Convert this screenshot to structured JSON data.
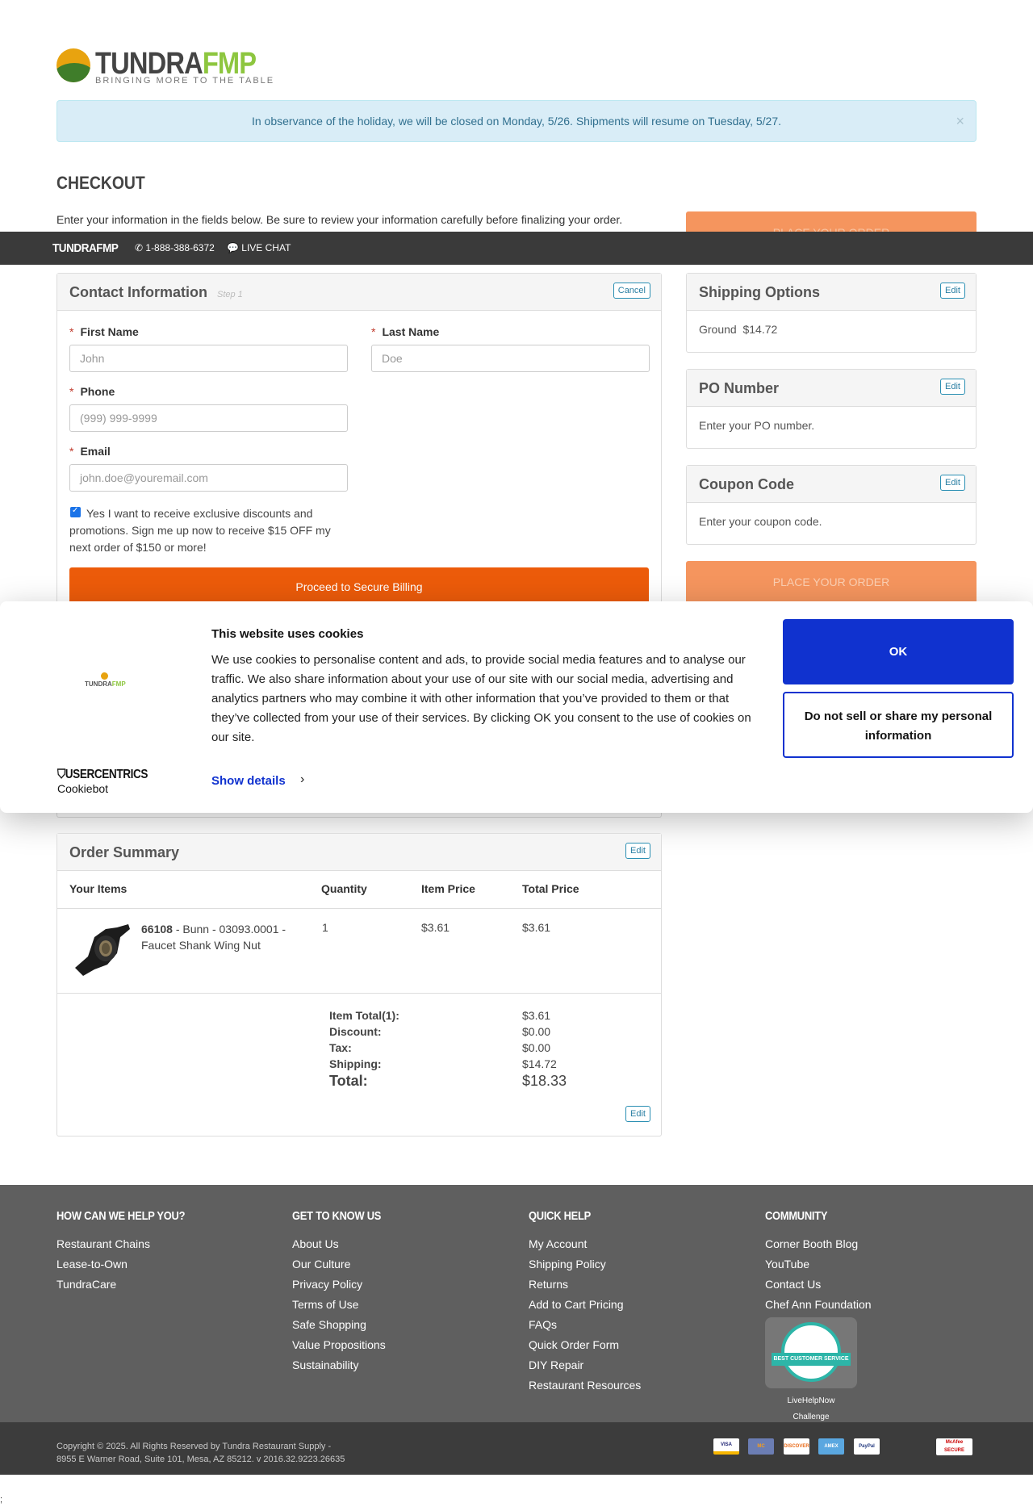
{
  "header": {
    "logo_part1": "TUNDRA",
    "logo_part2": "FMP",
    "tagline": "BRINGING MORE TO THE TABLE",
    "notice": "In observance of the holiday, we will be closed on Monday, 5/26. Shipments will resume on Tuesday, 5/27.",
    "notice_close": "×"
  },
  "checkout": {
    "title": "CHECKOUT",
    "intro": "Enter your information in the fields below. Be sure to review your information carefully before finalizing your order.",
    "place_order_label": "PLACE YOUR ORDER"
  },
  "sticky_bar": {
    "brand": "TUNDRAFMP",
    "phone": "1-888-388-6372",
    "chat": "LIVE CHAT"
  },
  "contact": {
    "title": "Contact Information",
    "step": "Step 1",
    "cancel_label": "Cancel",
    "first_name_label": "First Name",
    "first_name_placeholder": "John",
    "last_name_label": "Last Name",
    "last_name_placeholder": "Doe",
    "phone_label": "Phone",
    "phone_placeholder": "(999) 999-9999",
    "email_label": "Email",
    "email_placeholder": "john.doe@youremail.com",
    "required_mark": "*",
    "optin_text": "Yes I want to receive exclusive discounts and promotions. Sign me up now to receive $15 OFF my next order of $150 or more!",
    "optin_checked": true,
    "proceed_label": "Proceed to Secure Billing"
  },
  "side_panels": {
    "shipping": {
      "title": "Shipping Options",
      "edit": "Edit",
      "value": "Ground  $14.72"
    },
    "po": {
      "title": "PO Number",
      "edit": "Edit",
      "value": "Enter your PO number."
    },
    "coupon": {
      "title": "Coupon Code",
      "edit": "Edit",
      "value": "Enter your coupon code."
    }
  },
  "cookie_banner": {
    "logo_text_1": "TUNDRA",
    "logo_text_2": "FMP",
    "title": "This website uses cookies",
    "text": "We use cookies to personalise content and ads, to provide social media features and to analyse our traffic. We also share information about your use of our site with our social media, advertising and analytics partners who may combine it with other information that you’ve provided to them or that they’ve collected from your use of their services. By clicking OK you consent to the use of cookies on our site.",
    "show_details": "Show details",
    "chevron": "›",
    "brand": "USERCENTRICS",
    "brand_sub": "Cookiebot",
    "ok_label": "OK",
    "dns_label": "Do not sell or share my personal information"
  },
  "order_summary": {
    "title": "Order Summary",
    "edit": "Edit",
    "columns": [
      "Your Items",
      "Quantity",
      "Item Price",
      "Total Price"
    ],
    "item": {
      "sku": "66108",
      "desc": " - Bunn - 03093.0001 - Faucet Shank Wing Nut",
      "quantity": "1",
      "item_price": "$3.61",
      "total_price": "$3.61"
    },
    "totals": {
      "item_total_label": "Item Total(1):",
      "item_total": "$3.61",
      "discount_label": "Discount:",
      "discount": "$0.00",
      "tax_label": "Tax:",
      "tax": "$0.00",
      "shipping_label": "Shipping:",
      "shipping": "$14.72",
      "total_label": "Total:",
      "total": "$18.33"
    },
    "bottom_edit": "Edit"
  },
  "footer": {
    "col1": {
      "title": "HOW CAN WE HELP YOU?",
      "links": [
        "Restaurant Chains",
        "Lease-to-Own",
        "TundraCare"
      ]
    },
    "col2": {
      "title": "GET TO KNOW US",
      "links": [
        "About Us",
        "Our Culture",
        "Privacy Policy",
        "Terms of Use",
        "Safe Shopping",
        "Value Propositions",
        "Sustainability"
      ]
    },
    "col3": {
      "title": "QUICK HELP",
      "links": [
        "My Account",
        "Shipping Policy",
        "Returns",
        "Add to Cart Pricing",
        "FAQs",
        "Quick Order Form",
        "DIY Repair",
        "Restaurant Resources"
      ]
    },
    "col4": {
      "title": "COMMUNITY",
      "links": [
        "Corner Booth Blog",
        "YouTube",
        "Contact Us",
        "Chef Ann Foundation"
      ]
    },
    "badge_caption_1": "LiveHelpNow",
    "badge_caption_2": "Challenge",
    "badge_ribbon": "BEST CUSTOMER SERVICE",
    "copyright_1": "Copyright © 2025. All Rights Reserved by Tundra Restaurant Supply -",
    "copyright_2": "8955 E Warner Road, Suite 101, Mesa, AZ 85212. v 2016.32.9223.26635",
    "payments": [
      "VISA",
      "MC",
      "DISCOVER",
      "AMEX",
      "PayPal"
    ],
    "mcafee": "McAfee SECURE"
  },
  "trailing_text": ";",
  "colors": {
    "accent_orange": "#ec5b0a",
    "cookie_blue": "#1032cf",
    "notice_bg": "#d9edf7",
    "footer_bg": "#5f5f5f"
  }
}
